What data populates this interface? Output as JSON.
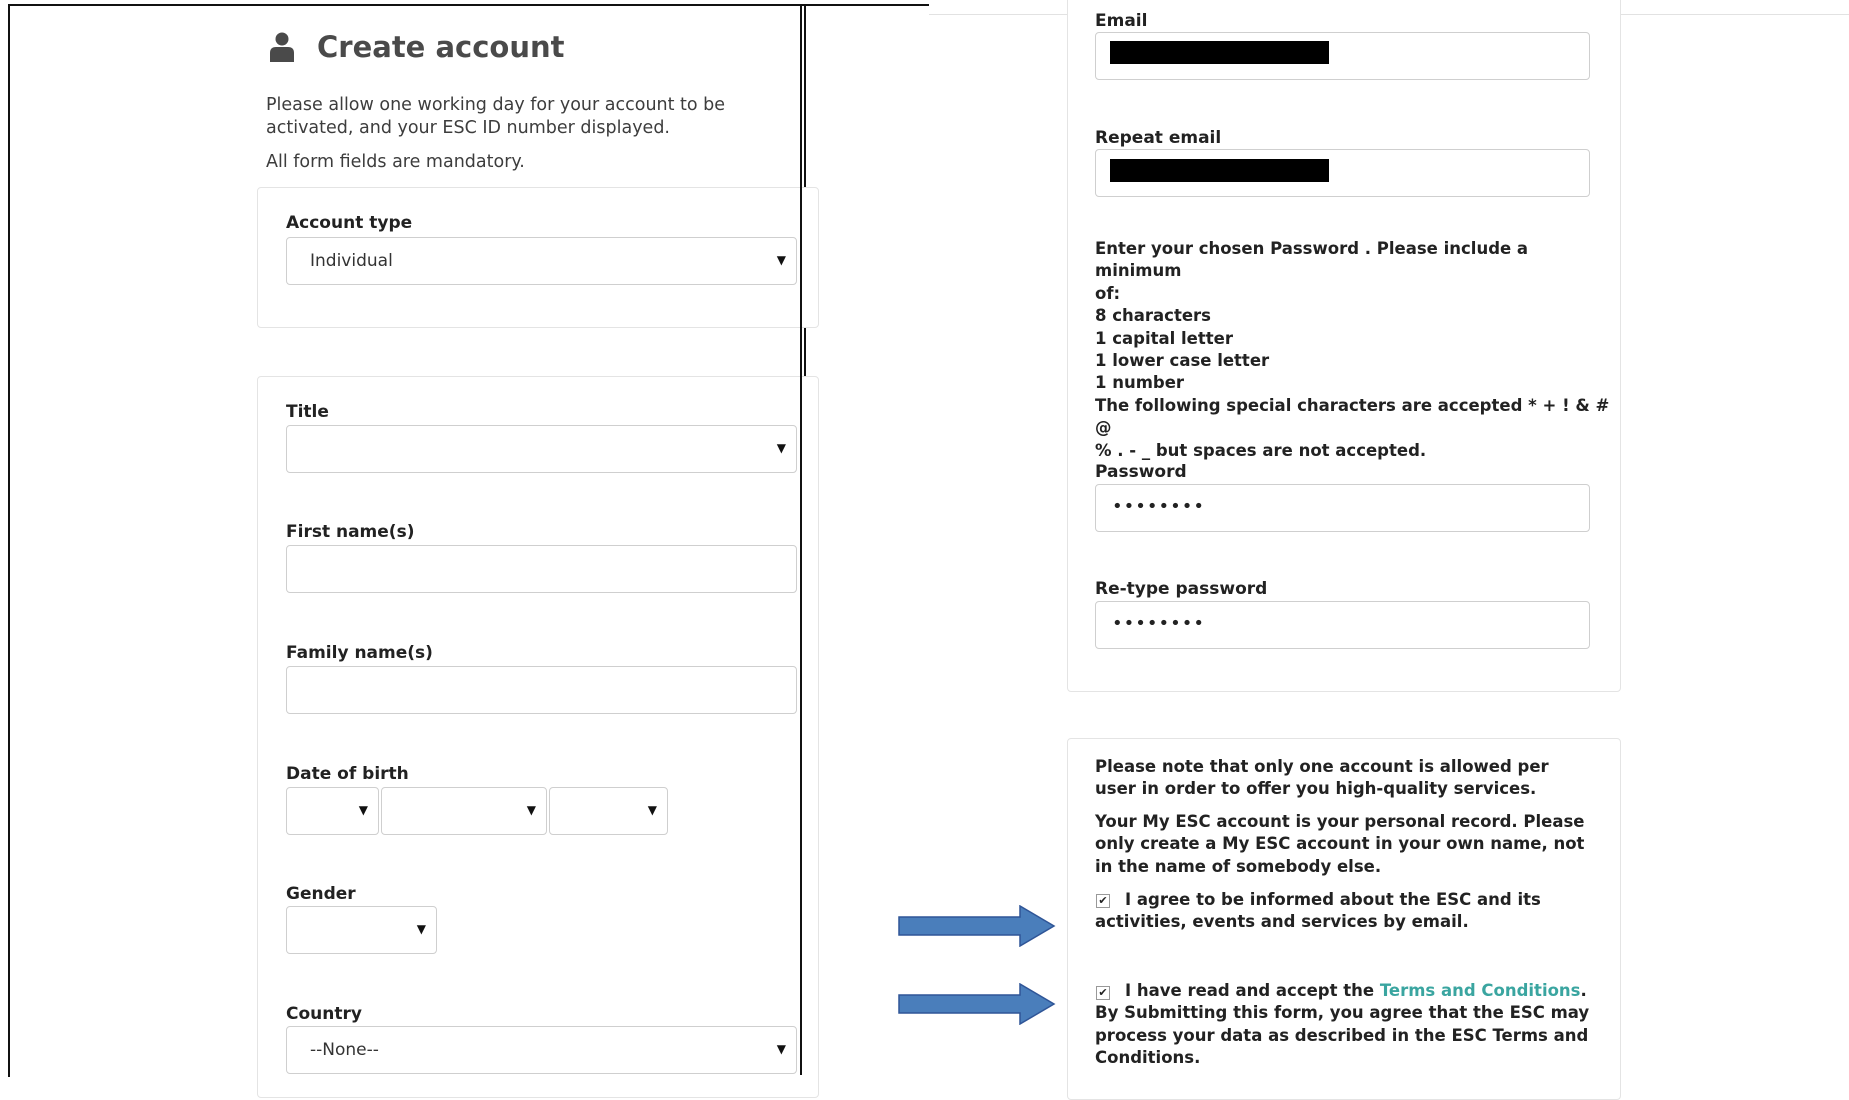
{
  "left": {
    "title": "Create account",
    "intro": "Please allow one working day for your account to be activated, and your ESC ID number displayed.",
    "mandatory_note": "All form fields are mandatory.",
    "account_type": {
      "label": "Account type",
      "value": "Individual"
    },
    "title_field": {
      "label": "Title",
      "value": ""
    },
    "first_name": {
      "label": "First name(s)",
      "value": ""
    },
    "family_name": {
      "label": "Family name(s)",
      "value": ""
    },
    "date_of_birth": {
      "label": "Date of birth"
    },
    "gender": {
      "label": "Gender",
      "value": ""
    },
    "country": {
      "label": "Country",
      "value": "--None--"
    }
  },
  "right": {
    "email": {
      "label": "Email"
    },
    "repeat_email": {
      "label": "Repeat email"
    },
    "password_rules": [
      "Enter your chosen Password . Please include a minimum",
      "of:",
      "8 characters",
      "1 capital letter",
      "1 lower case letter",
      "1 number",
      "The following special characters are accepted * + ! & # @",
      "% . - _ but spaces are not accepted."
    ],
    "password": {
      "label": "Password",
      "value": "••••••••"
    },
    "retype_password": {
      "label": "Re-type password",
      "value": "••••••••"
    },
    "notice_1": "Please note that only one account is allowed per user in order to offer you high-quality services.",
    "notice_2": "Your My ESC account is your personal record. Please only create a My ESC account in your own name, not in the name of somebody else.",
    "consent_marketing": {
      "checked": true,
      "text": "I agree to be informed about the ESC and its activities, events and services by email."
    },
    "consent_terms": {
      "checked": true,
      "text_before": "I have read and accept the ",
      "link": "Terms and Conditions",
      "text_after": ". By Submitting this form, you agree that the ESC may process your data as described in the ESC Terms and Conditions."
    }
  },
  "colors": {
    "arrow_fill": "#4a7ebb",
    "arrow_stroke": "#2f5597",
    "link": "#3aa5a0"
  },
  "icons": {
    "account": "user-icon",
    "dropdown": "chevron-down-icon",
    "checkbox": "checkmark-icon",
    "pointer": "arrow-right-icon"
  }
}
